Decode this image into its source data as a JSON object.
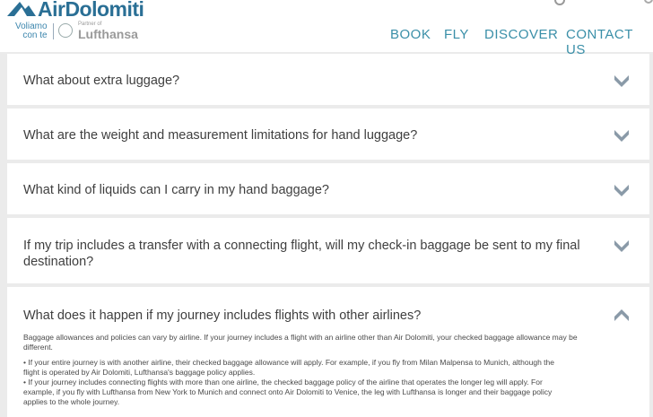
{
  "header": {
    "brand": "AirDolomiti",
    "tagline_line1": "Voliamo",
    "tagline_line2": "con te",
    "partner_small": "Partner of",
    "partner_name": "Lufthansa",
    "nav": [
      "BOOK",
      "FLY",
      "DISCOVER",
      "CONTACT US"
    ]
  },
  "faq": [
    {
      "question": "What about extra luggage?",
      "expanded": false
    },
    {
      "question": "What are the weight and measurement limitations for hand luggage?",
      "expanded": false
    },
    {
      "question": "What kind of liquids can I carry in my hand baggage?",
      "expanded": false
    },
    {
      "question_line1": "If my trip includes a transfer with a connecting flight, will my check-in baggage be sent to my final",
      "question_line2": "destination?",
      "expanded": false
    },
    {
      "question": "What does it happen if my journey includes flights with other airlines?",
      "expanded": true,
      "answer": {
        "intro_line1": "Baggage allowances and policies can vary by airline. If your journey includes a flight with an airline other than Air Dolomiti, your checked baggage allowance may be",
        "intro_line2": "different.",
        "bullet1_line1": "•    If your entire journey is with another airline, their checked baggage allowance will apply. For example, if you fly from Milan Malpensa to Munich, although the",
        "bullet1_line2": "flight is operated by Air Dolomiti, Lufthansa's baggage policy applies.",
        "bullet2_line1": "•    If your journey includes connecting flights with more than one airline, the checked baggage policy of the airline that operates the longer leg will apply. For",
        "bullet2_line2": "example, if you fly with Lufthansa from New York to Munich and connect onto Air Dolomiti to Venice, the leg with Lufthansa is longer and their baggage policy",
        "bullet2_line3": "applies to the whole journey."
      }
    }
  ],
  "colors": {
    "brand": "#2a6f95",
    "nav": "#3a8fa8",
    "chevron": "#8a9aa8",
    "background": "#ebebeb"
  },
  "icons": [
    "search-icon",
    "lufthansa-crane-icon",
    "chevron-down-icon",
    "chevron-up-icon"
  ]
}
